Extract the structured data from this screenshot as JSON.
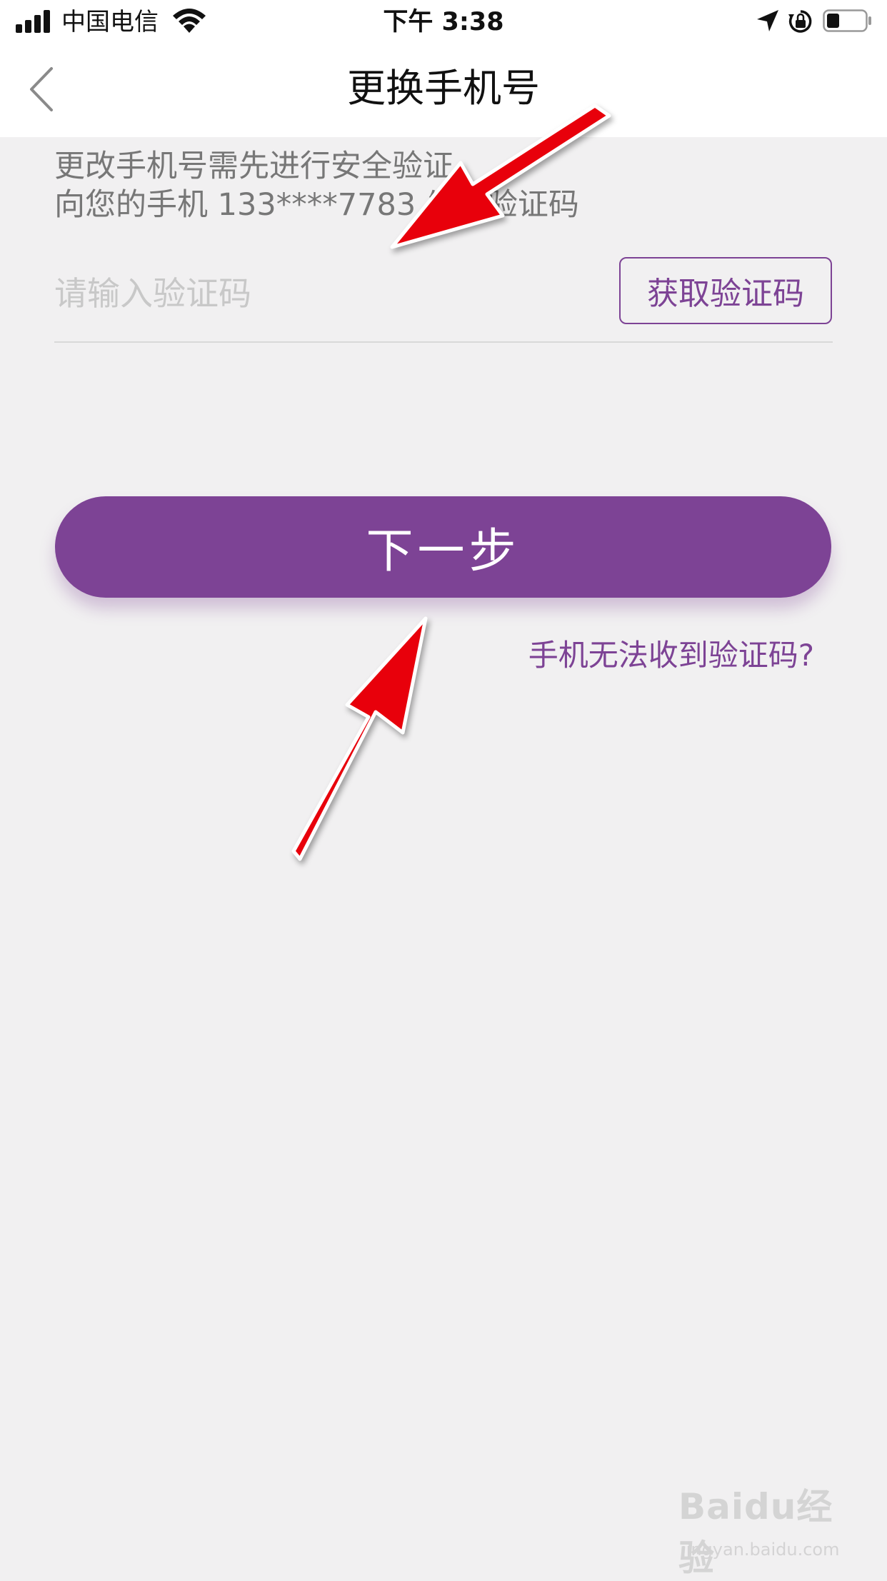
{
  "status_bar": {
    "carrier": "中国电信",
    "time": "下午 3:38"
  },
  "nav": {
    "title": "更换手机号"
  },
  "hint": {
    "line1": "更改手机号需先进行安全验证",
    "line2": "向您的手机 133****7783 发送验证码"
  },
  "form": {
    "code_placeholder": "请输入验证码",
    "get_code_label": "获取验证码"
  },
  "actions": {
    "next_label": "下一步",
    "help_link": "手机无法收到验证码?"
  },
  "watermark": {
    "logo": "Baidu经验",
    "url": "jingyan.baidu.com"
  },
  "colors": {
    "accent": "#7d4395",
    "background": "#f1f0f1",
    "annotation_arrow": "#e8000b"
  }
}
